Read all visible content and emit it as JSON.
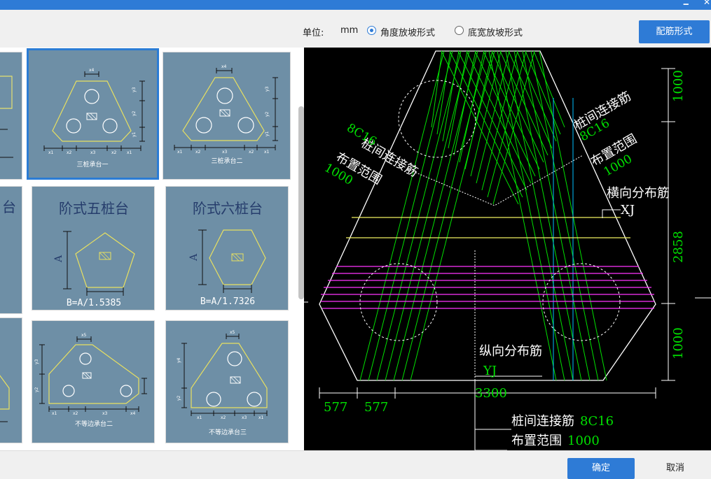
{
  "window": {
    "minimize_glyph": "🗕",
    "close_glyph": "✕"
  },
  "toolbar": {
    "unit_label": "单位:",
    "unit_value": "mm",
    "option_angle": "角度放坡形式",
    "option_width": "底宽放坡形式",
    "selected": "angle",
    "rebar_button": "配筋形式"
  },
  "thumbnails": [
    {
      "title": "三桩承台一",
      "selected": true
    },
    {
      "title": "三桩承台二",
      "selected": false
    },
    {
      "title": "阶式五桩台",
      "formula": "B=A/1.5385",
      "dim_label": "A"
    },
    {
      "title": "阶式六桩台",
      "formula": "B=A/1.7326",
      "dim_label": "A"
    },
    {
      "title": "不等边承台二"
    },
    {
      "title": "不等边承台三"
    },
    {
      "partial_title": "台"
    }
  ],
  "thumb_dims": {
    "x1": "x1",
    "x2": "x2",
    "x3": "x3",
    "x4": "x4",
    "x5": "x5",
    "y1": "y1",
    "y2": "y2",
    "y3": "y3",
    "y4": "y4"
  },
  "cad": {
    "left_label1": "桩间连接筋",
    "left_label2": "8C16",
    "left_label3": "布置范围",
    "left_label4": "1000",
    "right_label1": "桩间连接筋",
    "right_label2": "8C16",
    "right_label3": "布置范围",
    "right_label4": "1000",
    "horiz_label": "横向分布筋",
    "horiz_code": "XJ",
    "vert_label": "纵向分布筋",
    "vert_code": "YJ",
    "dim_top": "1000",
    "dim_mid": "2858",
    "dim_bot": "1000",
    "dim_width": "3300",
    "dim_a": "577",
    "dim_b": "577",
    "bottom_label1": "桩间连接筋",
    "bottom_val1": "8C16",
    "bottom_label2": "布置范围",
    "bottom_val2": "1000"
  },
  "buttons": {
    "ok": "确定",
    "cancel": "取消"
  },
  "colors": {
    "accent": "#2e7bd6",
    "thumb_bg": "#6e8fa6",
    "cad_green": "#00e000",
    "cad_magenta": "#ff33ff",
    "cad_yellow": "#f0f060"
  }
}
